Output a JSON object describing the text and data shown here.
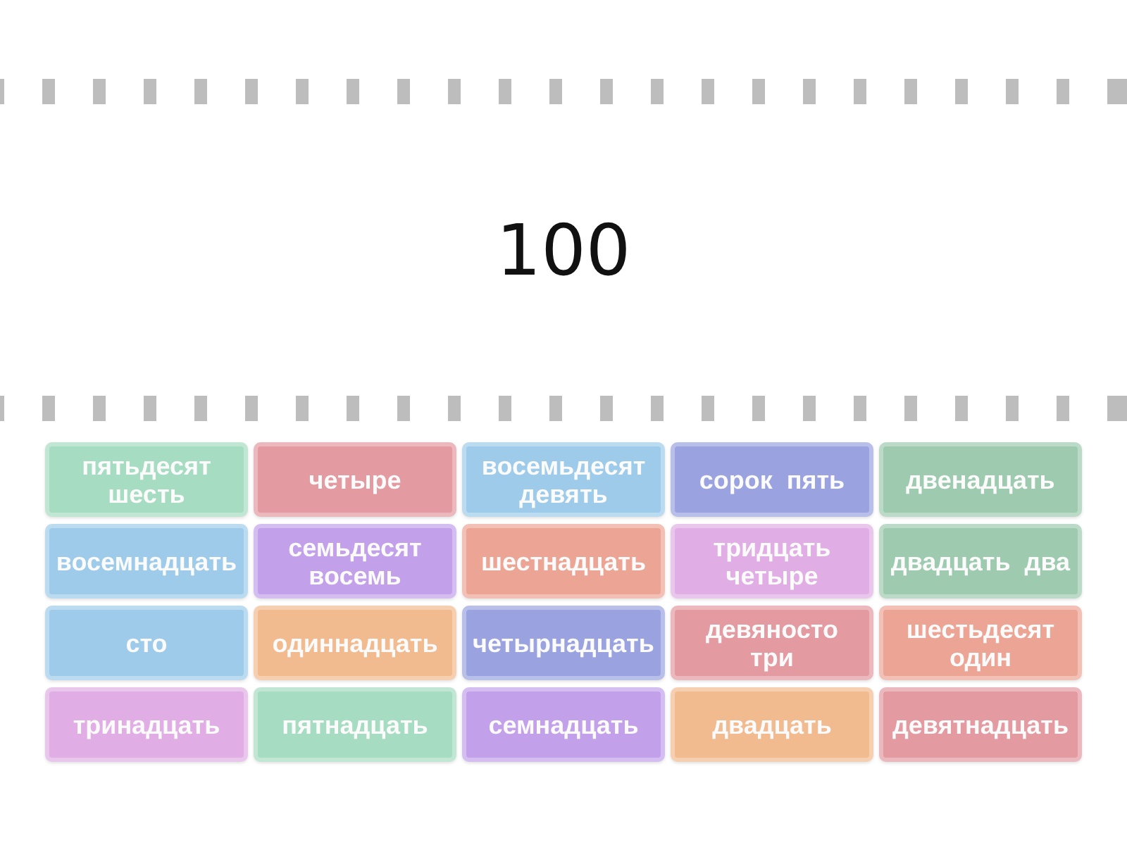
{
  "prompt": {
    "number": "100"
  },
  "tiles": [
    {
      "label": "пятьдесят шесть",
      "color": "#a6dcc2"
    },
    {
      "label": "четыре",
      "color": "#e39aa0"
    },
    {
      "label": "восемьдесят девять",
      "color": "#9dcbe9"
    },
    {
      "label": "сорок пять",
      "color": "#9aa3e0"
    },
    {
      "label": "двенадцать",
      "color": "#9ecab0"
    },
    {
      "label": "восемнадцать",
      "color": "#9dcbe9"
    },
    {
      "label": "семьдесят восемь",
      "color": "#c2a0ea"
    },
    {
      "label": "шестнадцать",
      "color": "#eca595"
    },
    {
      "label": "тридцать четыре",
      "color": "#e0aee4"
    },
    {
      "label": "двадцать два",
      "color": "#9ecab0"
    },
    {
      "label": "сто",
      "color": "#9dcbe9"
    },
    {
      "label": "одиннадцать",
      "color": "#f2ba8f"
    },
    {
      "label": "четырнадцать",
      "color": "#9aa3e0"
    },
    {
      "label": "девяносто три",
      "color": "#e39aa0"
    },
    {
      "label": "шестьдесят один",
      "color": "#eca595"
    },
    {
      "label": "тринадцать",
      "color": "#e0aee4"
    },
    {
      "label": "пятнадцать",
      "color": "#a6dcc2"
    },
    {
      "label": "семнадцать",
      "color": "#c2a0ea"
    },
    {
      "label": "двадцать",
      "color": "#f2ba8f"
    },
    {
      "label": "девятнадцать",
      "color": "#e39aa0"
    }
  ]
}
